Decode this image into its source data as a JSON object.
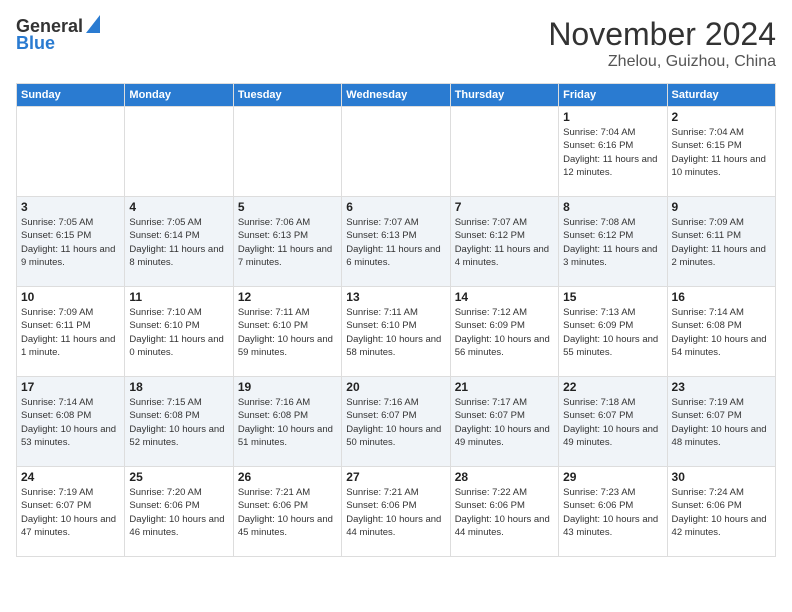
{
  "header": {
    "logo_line1": "General",
    "logo_line2": "Blue",
    "month": "November 2024",
    "location": "Zhelou, Guizhou, China"
  },
  "weekdays": [
    "Sunday",
    "Monday",
    "Tuesday",
    "Wednesday",
    "Thursday",
    "Friday",
    "Saturday"
  ],
  "weeks": [
    [
      {
        "day": "",
        "info": ""
      },
      {
        "day": "",
        "info": ""
      },
      {
        "day": "",
        "info": ""
      },
      {
        "day": "",
        "info": ""
      },
      {
        "day": "",
        "info": ""
      },
      {
        "day": "1",
        "info": "Sunrise: 7:04 AM\nSunset: 6:16 PM\nDaylight: 11 hours and 12 minutes."
      },
      {
        "day": "2",
        "info": "Sunrise: 7:04 AM\nSunset: 6:15 PM\nDaylight: 11 hours and 10 minutes."
      }
    ],
    [
      {
        "day": "3",
        "info": "Sunrise: 7:05 AM\nSunset: 6:15 PM\nDaylight: 11 hours and 9 minutes."
      },
      {
        "day": "4",
        "info": "Sunrise: 7:05 AM\nSunset: 6:14 PM\nDaylight: 11 hours and 8 minutes."
      },
      {
        "day": "5",
        "info": "Sunrise: 7:06 AM\nSunset: 6:13 PM\nDaylight: 11 hours and 7 minutes."
      },
      {
        "day": "6",
        "info": "Sunrise: 7:07 AM\nSunset: 6:13 PM\nDaylight: 11 hours and 6 minutes."
      },
      {
        "day": "7",
        "info": "Sunrise: 7:07 AM\nSunset: 6:12 PM\nDaylight: 11 hours and 4 minutes."
      },
      {
        "day": "8",
        "info": "Sunrise: 7:08 AM\nSunset: 6:12 PM\nDaylight: 11 hours and 3 minutes."
      },
      {
        "day": "9",
        "info": "Sunrise: 7:09 AM\nSunset: 6:11 PM\nDaylight: 11 hours and 2 minutes."
      }
    ],
    [
      {
        "day": "10",
        "info": "Sunrise: 7:09 AM\nSunset: 6:11 PM\nDaylight: 11 hours and 1 minute."
      },
      {
        "day": "11",
        "info": "Sunrise: 7:10 AM\nSunset: 6:10 PM\nDaylight: 11 hours and 0 minutes."
      },
      {
        "day": "12",
        "info": "Sunrise: 7:11 AM\nSunset: 6:10 PM\nDaylight: 10 hours and 59 minutes."
      },
      {
        "day": "13",
        "info": "Sunrise: 7:11 AM\nSunset: 6:10 PM\nDaylight: 10 hours and 58 minutes."
      },
      {
        "day": "14",
        "info": "Sunrise: 7:12 AM\nSunset: 6:09 PM\nDaylight: 10 hours and 56 minutes."
      },
      {
        "day": "15",
        "info": "Sunrise: 7:13 AM\nSunset: 6:09 PM\nDaylight: 10 hours and 55 minutes."
      },
      {
        "day": "16",
        "info": "Sunrise: 7:14 AM\nSunset: 6:08 PM\nDaylight: 10 hours and 54 minutes."
      }
    ],
    [
      {
        "day": "17",
        "info": "Sunrise: 7:14 AM\nSunset: 6:08 PM\nDaylight: 10 hours and 53 minutes."
      },
      {
        "day": "18",
        "info": "Sunrise: 7:15 AM\nSunset: 6:08 PM\nDaylight: 10 hours and 52 minutes."
      },
      {
        "day": "19",
        "info": "Sunrise: 7:16 AM\nSunset: 6:08 PM\nDaylight: 10 hours and 51 minutes."
      },
      {
        "day": "20",
        "info": "Sunrise: 7:16 AM\nSunset: 6:07 PM\nDaylight: 10 hours and 50 minutes."
      },
      {
        "day": "21",
        "info": "Sunrise: 7:17 AM\nSunset: 6:07 PM\nDaylight: 10 hours and 49 minutes."
      },
      {
        "day": "22",
        "info": "Sunrise: 7:18 AM\nSunset: 6:07 PM\nDaylight: 10 hours and 49 minutes."
      },
      {
        "day": "23",
        "info": "Sunrise: 7:19 AM\nSunset: 6:07 PM\nDaylight: 10 hours and 48 minutes."
      }
    ],
    [
      {
        "day": "24",
        "info": "Sunrise: 7:19 AM\nSunset: 6:07 PM\nDaylight: 10 hours and 47 minutes."
      },
      {
        "day": "25",
        "info": "Sunrise: 7:20 AM\nSunset: 6:06 PM\nDaylight: 10 hours and 46 minutes."
      },
      {
        "day": "26",
        "info": "Sunrise: 7:21 AM\nSunset: 6:06 PM\nDaylight: 10 hours and 45 minutes."
      },
      {
        "day": "27",
        "info": "Sunrise: 7:21 AM\nSunset: 6:06 PM\nDaylight: 10 hours and 44 minutes."
      },
      {
        "day": "28",
        "info": "Sunrise: 7:22 AM\nSunset: 6:06 PM\nDaylight: 10 hours and 44 minutes."
      },
      {
        "day": "29",
        "info": "Sunrise: 7:23 AM\nSunset: 6:06 PM\nDaylight: 10 hours and 43 minutes."
      },
      {
        "day": "30",
        "info": "Sunrise: 7:24 AM\nSunset: 6:06 PM\nDaylight: 10 hours and 42 minutes."
      }
    ]
  ]
}
